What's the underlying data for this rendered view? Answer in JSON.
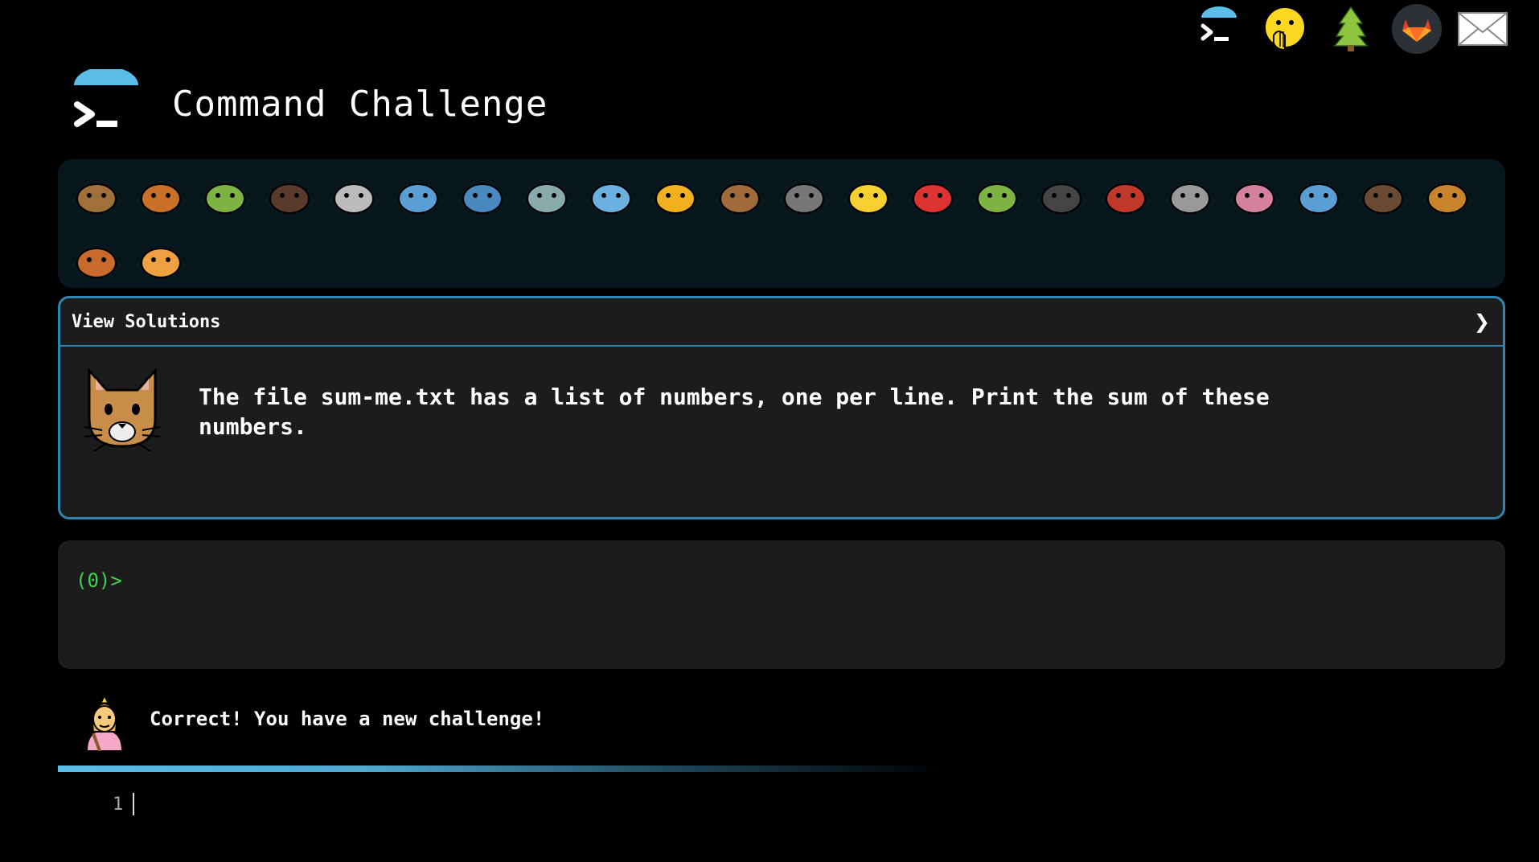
{
  "nav": {
    "items": [
      {
        "name": "terminal-logo-icon"
      },
      {
        "name": "face-hand-over-mouth-icon"
      },
      {
        "name": "tree-icon"
      },
      {
        "name": "gitlab-icon"
      },
      {
        "name": "mail-icon"
      }
    ]
  },
  "header": {
    "title": "Command Challenge"
  },
  "animals": [
    "snail",
    "butterfly",
    "caterpillar",
    "ant",
    "spider-web",
    "whale",
    "dolphin-jumping",
    "dolphin",
    "fish",
    "tropical-fish",
    "blowfish",
    "wolf",
    "bee",
    "ladybug",
    "cricket",
    "spider",
    "scorpion",
    "fly",
    "worm",
    "microbe",
    "monkey",
    "dog",
    "fox",
    "cat"
  ],
  "challenge": {
    "solutions_label": "View Solutions",
    "chevron": "❯",
    "text": "The file sum-me.txt has a list of numbers, one per line. Print the sum of these numbers."
  },
  "terminal": {
    "prompt": "(0)>"
  },
  "status": {
    "message": "Correct! You have a new challenge!"
  },
  "editor": {
    "line_number": "1"
  },
  "colors": {
    "accent": "#2e87b3",
    "prompt": "#41d24b",
    "panel": "#1c1c1c",
    "strip": "#08161e"
  }
}
